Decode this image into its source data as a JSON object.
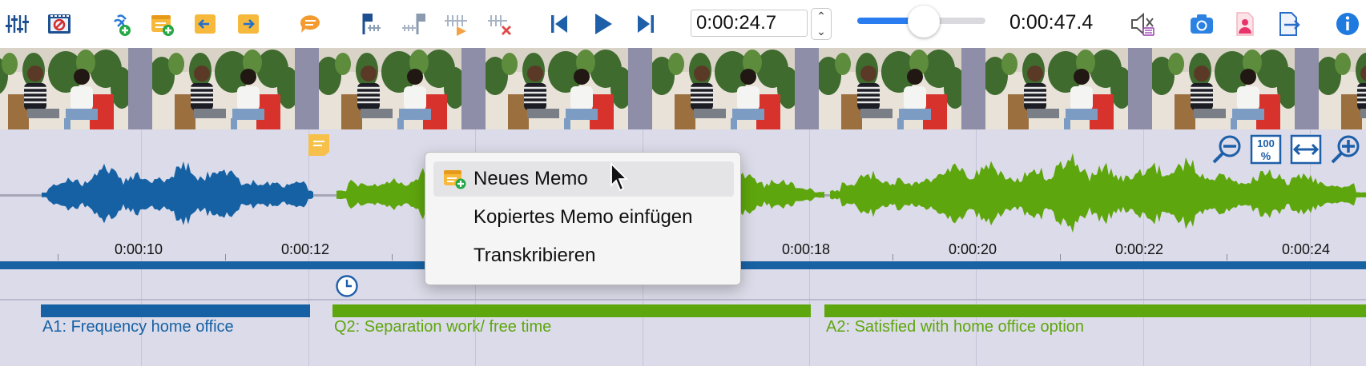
{
  "toolbar": {
    "icons": [
      {
        "name": "mixer-sliders-icon"
      },
      {
        "name": "video-player-icon"
      },
      {
        "name": "link-add-icon"
      },
      {
        "name": "new-memo-icon"
      },
      {
        "name": "memo-previous-icon"
      },
      {
        "name": "memo-next-icon"
      },
      {
        "name": "comment-icon"
      },
      {
        "name": "set-start-marker-icon"
      },
      {
        "name": "set-end-marker-icon"
      },
      {
        "name": "play-segment-icon"
      },
      {
        "name": "delete-markers-icon"
      },
      {
        "name": "skip-back-icon"
      },
      {
        "name": "play-icon"
      },
      {
        "name": "skip-forward-icon"
      },
      {
        "name": "speaker-settings-icon"
      },
      {
        "name": "camera-icon"
      },
      {
        "name": "image-export-icon"
      },
      {
        "name": "export-doc-icon"
      },
      {
        "name": "info-icon"
      }
    ],
    "current_time": "0:00:24.7",
    "total_time": "0:00:47.4",
    "volume_fraction": 0.52
  },
  "timeline": {
    "tick_labels": [
      "0:00:10",
      "0:00:12",
      "0:00:18",
      "0:00:20",
      "0:00:22",
      "0:00:24"
    ],
    "codes": [
      {
        "label": "A1: Frequency home office",
        "color": "#1561a3"
      },
      {
        "label": "Q2: Separation work/ free time",
        "color": "#5ea60d"
      },
      {
        "label": "A2: Satisfied with home office option",
        "color": "#5ea60d"
      }
    ],
    "waveform_colors": {
      "blue": "#1561a3",
      "green": "#5ea60d"
    }
  },
  "context_menu": {
    "items": [
      {
        "label": "Neues Memo"
      },
      {
        "label": "Kopiertes Memo einfügen"
      },
      {
        "label": "Transkribieren"
      }
    ]
  }
}
